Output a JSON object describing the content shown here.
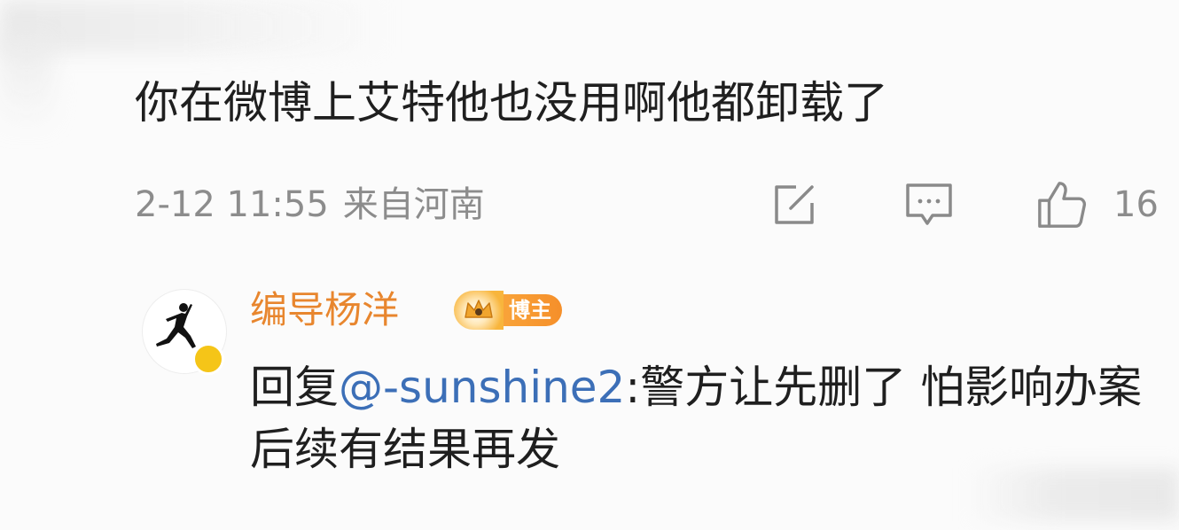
{
  "comment": {
    "text": "你在微博上艾特他也没用啊他都卸载了",
    "date": "2-12 11:55",
    "location": "来自河南",
    "like_count": "16"
  },
  "actions": {
    "share_icon": "share-icon",
    "comment_icon": "comment-icon",
    "like_icon": "thumbs-up-icon"
  },
  "reply": {
    "username": "编导杨洋",
    "badge": "博主",
    "prefix": "回复",
    "mention": "@-sunshine2",
    "body": ":警方让先删了 怕影响办案 后续有结果再发"
  },
  "colors": {
    "text": "#1f1f1f",
    "meta": "#8c8c8c",
    "username": "#e8862e",
    "mention": "#3c6fb7",
    "badge": "#f58f2a"
  }
}
